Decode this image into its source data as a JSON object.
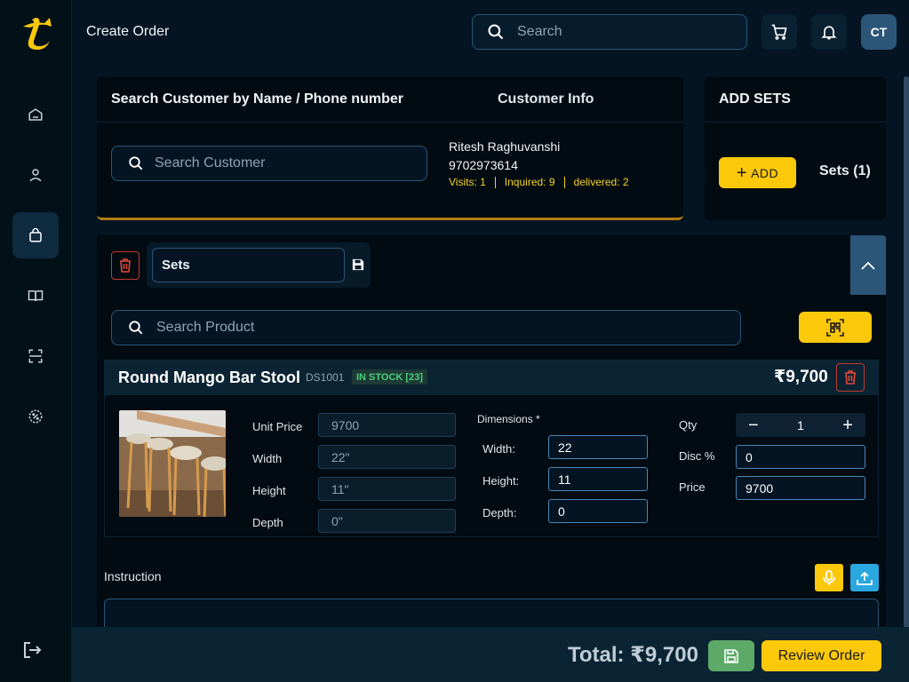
{
  "header": {
    "title": "Create Order",
    "search_placeholder": "Search",
    "avatar_initials": "CT"
  },
  "customer": {
    "search_heading": "Search Customer by Name / Phone number",
    "info_heading": "Customer Info",
    "search_placeholder": "Search Customer",
    "name": "Ritesh Raghuvanshi",
    "phone": "9702973614",
    "visits": "Visits: 1",
    "inquired": "Inquired: 9",
    "delivered": "delivered: 2"
  },
  "sets": {
    "heading": "ADD SETS",
    "add_label": "ADD",
    "count_label": "Sets (1)",
    "set_name": "Sets"
  },
  "product_search": {
    "placeholder": "Search Product"
  },
  "product": {
    "name": "Round Mango Bar Stool",
    "code": "DS1001",
    "stock": "IN STOCK [23]",
    "price": "₹9,700",
    "unit_price_label": "Unit Price",
    "unit_price": "9700",
    "width_label": "Width",
    "width": "22\"",
    "height_label": "Height",
    "height": "11\"",
    "depth_label": "Depth",
    "depth": "0\"",
    "dimensions_label": "Dimensions *",
    "dim_width_label": "Width:",
    "dim_width": "22",
    "dim_height_label": "Height:",
    "dim_height": "11",
    "dim_depth_label": "Depth:",
    "dim_depth": "0",
    "qty_label": "Qty",
    "qty": "1",
    "disc_label": "Disc %",
    "disc": "0",
    "price_label": "Price",
    "price_value": "9700"
  },
  "instruction": {
    "label": "Instruction"
  },
  "footer": {
    "total": "Total: ₹9,700",
    "review_label": "Review Order"
  },
  "colors": {
    "accent_yellow": "#fcc80a",
    "background": "#041422",
    "border_blue": "#2a5677",
    "stock_green": "#4ad07a",
    "danger_red": "#c0392b"
  }
}
